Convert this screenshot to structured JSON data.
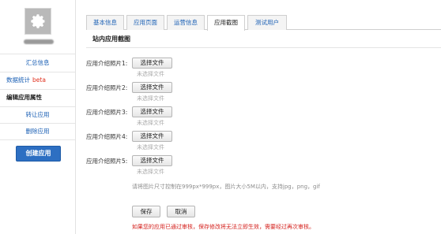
{
  "sidebar": {
    "app_name": "",
    "items": [
      {
        "label": "汇总信息"
      },
      {
        "label": "数据统计",
        "badge": "beta"
      },
      {
        "label": "编辑应用属性"
      },
      {
        "label": "转让应用"
      },
      {
        "label": "删除应用"
      }
    ],
    "create_button": "创建应用"
  },
  "tabs": [
    {
      "label": "基本信息",
      "active": false
    },
    {
      "label": "应用页面",
      "active": false
    },
    {
      "label": "运营信息",
      "active": false
    },
    {
      "label": "应用截图",
      "active": true
    },
    {
      "label": "测试用户",
      "active": false
    }
  ],
  "section_title": "站内应用截图",
  "uploads": [
    {
      "label": "应用介绍照片1:",
      "button": "选择文件",
      "hint": "未选择文件"
    },
    {
      "label": "应用介绍照片2:",
      "button": "选择文件",
      "hint": "未选择文件"
    },
    {
      "label": "应用介绍照片3:",
      "button": "选择文件",
      "hint": "未选择文件"
    },
    {
      "label": "应用介绍照片4:",
      "button": "选择文件",
      "hint": "未选择文件"
    },
    {
      "label": "应用介绍照片5:",
      "button": "选择文件",
      "hint": "未选择文件"
    }
  ],
  "size_hint": "请将图片尺寸控制在999px*999px，图片大小5M以内，支持jpg，png，gif",
  "save_button": "保存",
  "cancel_button": "取消",
  "warning": "如果您的应用已通过审核，保存修改将无法立即生效，需要经过再次审核。",
  "colors": {
    "link": "#1a5fb4",
    "beta": "#e0301e",
    "primary_button": "#2d6fc2",
    "warning": "#d4201c"
  },
  "icons": {
    "app_icon": "gear-icon"
  }
}
